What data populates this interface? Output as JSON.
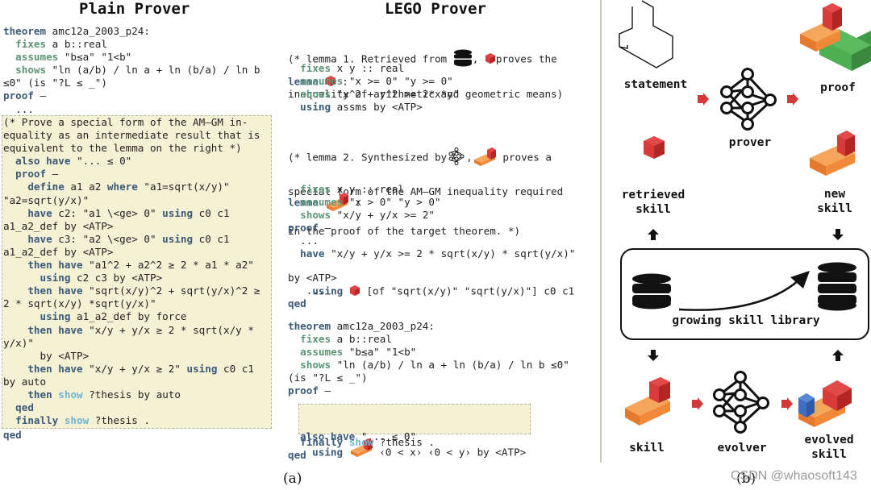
{
  "panel_a": {
    "plain_prover": {
      "title": "Plain Prover",
      "header_lines": [
        [
          {
            "t": "theorem",
            "c": "blue"
          },
          {
            "t": " amc12a_2003_p24:"
          }
        ],
        [
          {
            "t": "  "
          },
          {
            "t": "fixes",
            "c": "green"
          },
          {
            "t": " a b::real"
          }
        ],
        [
          {
            "t": "  "
          },
          {
            "t": "assumes",
            "c": "green"
          },
          {
            "t": " \"b≤a\" \"1<b\""
          }
        ],
        [
          {
            "t": "  "
          },
          {
            "t": "shows",
            "c": "green"
          },
          {
            "t": " \"ln (a/b) / ln a + ln (b/a) / ln b"
          }
        ],
        [
          {
            "t": "≤0\" (is \"?L ≤ _\")"
          }
        ],
        [
          {
            "t": "proof",
            "c": "blue"
          },
          {
            "t": " –"
          }
        ],
        [
          {
            "t": "  ..."
          }
        ]
      ],
      "highlight_lines": [
        [
          {
            "t": "(* Prove a special form of the AM–GM in-"
          }
        ],
        [
          {
            "t": "equality as an intermediate result that is"
          }
        ],
        [
          {
            "t": "equivalent to the lemma on the right *)"
          }
        ],
        [
          {
            "t": "  "
          },
          {
            "t": "also have",
            "c": "blue"
          },
          {
            "t": " \"... ≤ 0\""
          }
        ],
        [
          {
            "t": "  "
          },
          {
            "t": "proof",
            "c": "blue"
          },
          {
            "t": " –"
          }
        ],
        [
          {
            "t": "    "
          },
          {
            "t": "define",
            "c": "blue"
          },
          {
            "t": " a1 a2 "
          },
          {
            "t": "where",
            "c": "blue"
          },
          {
            "t": " \"a1=sqrt(x/y)\""
          }
        ],
        [
          {
            "t": "\"a2=sqrt(y/x)\""
          }
        ],
        [
          {
            "t": "    "
          },
          {
            "t": "have",
            "c": "blue"
          },
          {
            "t": " c2: \"a1 \\<ge> 0\" "
          },
          {
            "t": "using",
            "c": "blue"
          },
          {
            "t": " c0 c1"
          }
        ],
        [
          {
            "t": "a1_a2_def by <ATP>"
          }
        ],
        [
          {
            "t": "    "
          },
          {
            "t": "have",
            "c": "blue"
          },
          {
            "t": " c3: \"a2 \\<ge> 0\" "
          },
          {
            "t": "using",
            "c": "blue"
          },
          {
            "t": " c0 c1"
          }
        ],
        [
          {
            "t": "a1_a2_def by <ATP>"
          }
        ],
        [
          {
            "t": "    "
          },
          {
            "t": "then have",
            "c": "blue"
          },
          {
            "t": " \"a1^2 + a2^2 ≥ 2 * a1 * a2\""
          }
        ],
        [
          {
            "t": "      "
          },
          {
            "t": "using",
            "c": "blue"
          },
          {
            "t": " c2 c3 by <ATP>"
          }
        ],
        [
          {
            "t": "    "
          },
          {
            "t": "then have",
            "c": "blue"
          },
          {
            "t": " \"sqrt(x/y)^2 + sqrt(y/x)^2 ≥"
          }
        ],
        [
          {
            "t": "2 * sqrt(x/y) *sqrt(y/x)\""
          }
        ],
        [
          {
            "t": "      "
          },
          {
            "t": "using",
            "c": "blue"
          },
          {
            "t": " a1_a2_def by force"
          }
        ],
        [
          {
            "t": "    "
          },
          {
            "t": "then have",
            "c": "blue"
          },
          {
            "t": " \"x/y + y/x ≥ 2 * sqrt(x/y *"
          }
        ],
        [
          {
            "t": "y/x)\""
          }
        ],
        [
          {
            "t": "      by <ATP>"
          }
        ],
        [
          {
            "t": "    "
          },
          {
            "t": "then have",
            "c": "blue"
          },
          {
            "t": " \"x/y + y/x ≥ 2\" "
          },
          {
            "t": "using",
            "c": "blue"
          },
          {
            "t": " c0 c1"
          }
        ],
        [
          {
            "t": "by auto"
          }
        ],
        [
          {
            "t": "    "
          },
          {
            "t": "then",
            "c": "blue"
          },
          {
            "t": " "
          },
          {
            "t": "show",
            "c": "cyan"
          },
          {
            "t": " ?thesis by auto"
          }
        ],
        [
          {
            "t": "  "
          },
          {
            "t": "qed",
            "c": "blue"
          }
        ],
        [
          {
            "t": "  "
          },
          {
            "t": "finally",
            "c": "blue"
          },
          {
            "t": " "
          },
          {
            "t": "show",
            "c": "cyan"
          },
          {
            "t": " ?thesis ."
          }
        ]
      ],
      "footer_lines": [
        [
          {
            "t": "qed",
            "c": "blue"
          }
        ]
      ]
    },
    "lego_prover": {
      "title": "LEGO Prover",
      "lemma1_comment": {
        "line1_a": "(* lemma 1. Retrieved from ",
        "line1_b": ", ",
        "line1_c": "proves the",
        "line2": "inequality of arithmetic and geometric means)"
      },
      "lemma1_head": {
        "kw": "lemma",
        "tail": " :"
      },
      "lemma1_lines": [
        [
          {
            "t": "  "
          },
          {
            "t": "fixes",
            "c": "green"
          },
          {
            "t": " x y :: real"
          }
        ],
        [
          {
            "t": "  "
          },
          {
            "t": "assumes",
            "c": "green"
          },
          {
            "t": " \"x >= 0\" \"y >= 0\""
          }
        ],
        [
          {
            "t": "  "
          },
          {
            "t": "shows",
            "c": "green"
          },
          {
            "t": " \"x^2 + y^2 >= 2*x*y\""
          }
        ],
        [
          {
            "t": "  "
          },
          {
            "t": "using",
            "c": "blue"
          },
          {
            "t": " assms by <ATP>"
          }
        ]
      ],
      "lemma2_comment": {
        "line1_a": "(* lemma 2. Synthesized by",
        "line1_b": ",",
        "line1_c": " proves a",
        "line2": "special form of the AM–GM inequality required",
        "line3": "in the proof of the target theorem. *)"
      },
      "lemma2_head": {
        "kw": "lemma",
        "tail": " :"
      },
      "lemma2_lines": [
        [
          {
            "t": "  "
          },
          {
            "t": "fixes",
            "c": "green"
          },
          {
            "t": " x y :: real"
          }
        ],
        [
          {
            "t": "  "
          },
          {
            "t": "assumes",
            "c": "green"
          },
          {
            "t": " \"x > 0\" \"y > 0\""
          }
        ],
        [
          {
            "t": "  "
          },
          {
            "t": "shows",
            "c": "green"
          },
          {
            "t": " \"x/y + y/x >= 2\""
          }
        ],
        [
          {
            "t": "proof",
            "c": "blue"
          },
          {
            "t": " –"
          }
        ],
        [
          {
            "t": "  ..."
          }
        ],
        [
          {
            "t": "  "
          },
          {
            "t": "have",
            "c": "blue"
          },
          {
            "t": " \"x/y + y/x >= 2 * sqrt(x/y) * sqrt(y/x)\""
          }
        ]
      ],
      "lemma2_using": {
        "kw": "using",
        "tail": " [of \"sqrt(x/y)\" \"sqrt(y/x)\"] c0 c1"
      },
      "lemma2_after": [
        [
          {
            "t": "by <ATP>"
          }
        ],
        [
          {
            "t": "   ..."
          }
        ],
        [
          {
            "t": "qed",
            "c": "blue"
          }
        ]
      ],
      "theorem_lines": [
        [
          {
            "t": "theorem",
            "c": "blue"
          },
          {
            "t": " amc12a_2003_p24:"
          }
        ],
        [
          {
            "t": "  "
          },
          {
            "t": "fixes",
            "c": "green"
          },
          {
            "t": " a b::real"
          }
        ],
        [
          {
            "t": "  "
          },
          {
            "t": "assumes",
            "c": "green"
          },
          {
            "t": " \"b≤a\" \"1<b\""
          }
        ],
        [
          {
            "t": "  "
          },
          {
            "t": "shows",
            "c": "green"
          },
          {
            "t": " \"ln (a/b) / ln a + ln (b/a) / ln b ≤0\""
          }
        ],
        [
          {
            "t": "(is \"?L ≤ _\")"
          }
        ],
        [
          {
            "t": "proof",
            "c": "blue"
          },
          {
            "t": " –"
          }
        ],
        [
          {
            "t": "  ..."
          }
        ]
      ],
      "theorem_highlight": {
        "line1": [
          {
            "t": "also have",
            "c": "blue"
          },
          {
            "t": " \"... ≤ 0\""
          }
        ],
        "line2_kw": "using",
        "line2_tail": " ‹0 < x› ‹0 < y› by <ATP>"
      },
      "theorem_end": [
        [
          {
            "t": "  "
          },
          {
            "t": "finally",
            "c": "blue"
          },
          {
            "t": " "
          },
          {
            "t": "show",
            "c": "cyan"
          },
          {
            "t": " ?thesis ."
          }
        ],
        [
          {
            "t": "qed",
            "c": "blue"
          }
        ]
      ]
    },
    "caption": "(a)"
  },
  "panel_b": {
    "labels": {
      "statement": "statement",
      "prover": "prover",
      "proof": "proof",
      "retrieved_skill_1": "retrieved",
      "retrieved_skill_2": "skill",
      "new_skill_1": "new",
      "new_skill_2": "skill",
      "library": "growing skill library",
      "skill": "skill",
      "evolver": "evolver",
      "evolved_skill_1": "evolved",
      "evolved_skill_2": "skill"
    },
    "caption": "(b)"
  },
  "colors": {
    "keyword_blue": "#3b5a78",
    "keyword_green": "#5c9676",
    "keyword_cyan": "#6fb4cf",
    "highlight_bg": "#f5f1d5",
    "arrow_red": "#d23a3a",
    "brick_red": "#d93a3a",
    "brick_orange": "#f08a3a",
    "brick_green": "#4caf50",
    "brick_blue": "#3f6fc4"
  },
  "watermark": "CSDN @whaosoft143"
}
